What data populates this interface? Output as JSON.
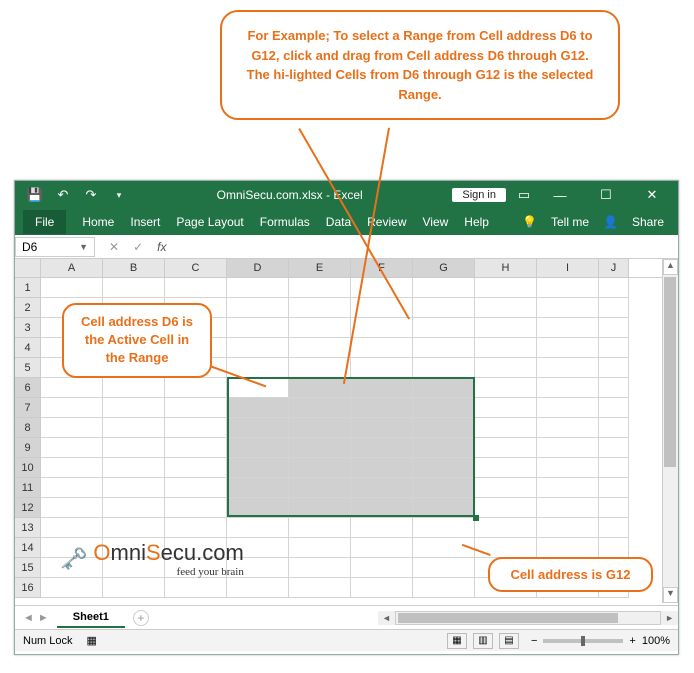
{
  "callouts": {
    "top": "For Example; To select a Range from Cell address D6 to G12, click and drag from Cell address D6 through G12.\nThe hi-lighted Cells from D6 through G12 is the selected Range.",
    "left": "Cell address D6 is the Active Cell in the Range",
    "right": "Cell address is G12"
  },
  "window": {
    "title": "OmniSecu.com.xlsx - Excel",
    "signin": "Sign in"
  },
  "tabs": {
    "file": "File",
    "home": "Home",
    "insert": "Insert",
    "pagelayout": "Page Layout",
    "formulas": "Formulas",
    "data": "Data",
    "review": "Review",
    "view": "View",
    "help": "Help",
    "tellme": "Tell me",
    "share": "Share"
  },
  "formulabar": {
    "namebox": "D6",
    "fx": "fx"
  },
  "columns": [
    "A",
    "B",
    "C",
    "D",
    "E",
    "F",
    "G",
    "H",
    "I",
    "J"
  ],
  "rows": [
    "1",
    "2",
    "3",
    "4",
    "5",
    "6",
    "7",
    "8",
    "9",
    "10",
    "11",
    "12",
    "13",
    "14",
    "15",
    "16"
  ],
  "selection": {
    "startCol": "D",
    "endCol": "G",
    "startRow": 6,
    "endRow": 12,
    "active": "D6"
  },
  "sheettab": {
    "name": "Sheet1"
  },
  "status": {
    "numlock": "Num Lock",
    "zoom": "100%"
  },
  "logo": {
    "brand_pre": "O",
    "brand_mid": "mni",
    "brand_s": "S",
    "brand_rest": "ecu.com",
    "tag": "feed your brain"
  },
  "chart_data": {
    "type": "table",
    "description": "Excel spreadsheet with selected cell range D6:G12. All cells are empty. D6 is the active cell (white background) within the grey selection.",
    "selected_range": "D6:G12",
    "active_cell": "D6",
    "cells": {}
  }
}
